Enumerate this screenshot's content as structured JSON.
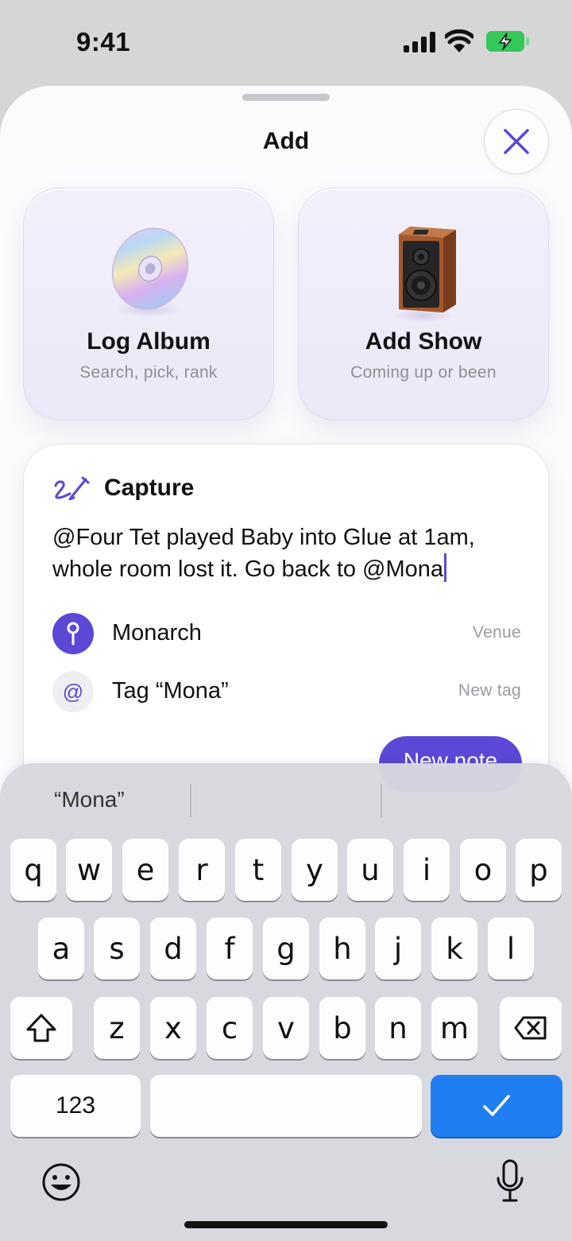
{
  "status_bar": {
    "time": "9:41"
  },
  "sheet": {
    "title": "Add"
  },
  "actions": {
    "log_album": {
      "title": "Log Album",
      "subtitle": "Search, pick, rank"
    },
    "add_show": {
      "title": "Add Show",
      "subtitle": "Coming up or been"
    }
  },
  "capture": {
    "title": "Capture",
    "text": "@Four Tet played Baby into Glue at 1am, whole room lost it. Go back to @Mona",
    "suggestions": [
      {
        "label": "Monarch",
        "kind": "Venue"
      },
      {
        "label": "Tag “Mona”",
        "kind": "New tag"
      }
    ],
    "new_note_label": "New note"
  },
  "keyboard": {
    "prediction": "“Mona”",
    "row1": [
      "q",
      "w",
      "e",
      "r",
      "t",
      "y",
      "u",
      "i",
      "o",
      "p"
    ],
    "row2": [
      "a",
      "s",
      "d",
      "f",
      "g",
      "h",
      "j",
      "k",
      "l"
    ],
    "row3": [
      "z",
      "x",
      "c",
      "v",
      "b",
      "n",
      "m"
    ],
    "numbers_label": "123"
  },
  "colors": {
    "accent": "#5b48d6",
    "done_key": "#1f7ff2",
    "battery": "#34c759"
  }
}
